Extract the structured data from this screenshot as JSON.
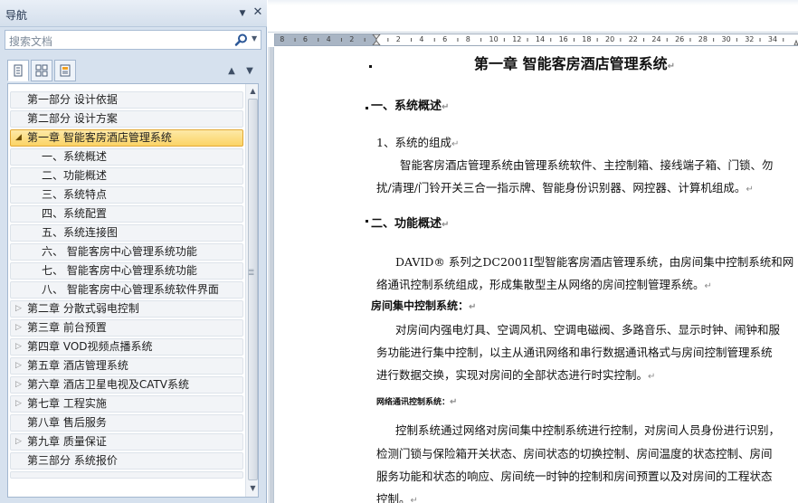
{
  "nav": {
    "title": "导航",
    "close_glyph": "✕",
    "menu_glyph": "▼",
    "search_placeholder": "搜索文档",
    "view_tabs": [
      "headings-view-icon",
      "pages-view-icon",
      "results-view-icon"
    ],
    "items": [
      {
        "label": "第一部分  设计依据",
        "level": 1,
        "expander": ""
      },
      {
        "label": "第二部分 设计方案",
        "level": 1,
        "expander": ""
      },
      {
        "label": "第一章  智能客房酒店管理系统",
        "level": 1,
        "expander": "◢",
        "selected": true
      },
      {
        "label": "一、系统概述",
        "level": 2,
        "expander": ""
      },
      {
        "label": "二、功能概述",
        "level": 2,
        "expander": ""
      },
      {
        "label": "三、系统特点",
        "level": 2,
        "expander": ""
      },
      {
        "label": "四、系统配置",
        "level": 2,
        "expander": ""
      },
      {
        "label": "五、系统连接图",
        "level": 2,
        "expander": ""
      },
      {
        "label": "六、  智能客房中心管理系统功能",
        "level": 2,
        "expander": ""
      },
      {
        "label": "七、   智能客房中心管理系统功能",
        "level": 2,
        "expander": ""
      },
      {
        "label": "八、   智能客房中心管理系统软件界面",
        "level": 2,
        "expander": ""
      },
      {
        "label": "第二章    分散式弱电控制",
        "level": 1,
        "expander": "▷"
      },
      {
        "label": "第三章  前台预置",
        "level": 1,
        "expander": "▷"
      },
      {
        "label": "第四章  VOD视频点播系统",
        "level": 1,
        "expander": "▷"
      },
      {
        "label": "第五章  酒店管理系统",
        "level": 1,
        "expander": "▷"
      },
      {
        "label": "第六章  酒店卫星电视及CATV系统",
        "level": 1,
        "expander": "▷"
      },
      {
        "label": "第七章  工程实施",
        "level": 1,
        "expander": "▷"
      },
      {
        "label": "第八章 售后服务",
        "level": 1,
        "expander": ""
      },
      {
        "label": "第九章 质量保证",
        "level": 1,
        "expander": "▷"
      },
      {
        "label": "第三部分  系统报价",
        "level": 1,
        "expander": ""
      }
    ]
  },
  "ruler": {
    "labels": [
      "8",
      "6",
      "4",
      "2",
      "2",
      "4",
      "6",
      "8",
      "10",
      "12",
      "14",
      "16",
      "18",
      "20",
      "22",
      "24",
      "26",
      "28",
      "30",
      "32",
      "34"
    ]
  },
  "document": {
    "chapter_title": "第一章   智能客房酒店管理系统",
    "s1_heading": "一、系统概述",
    "s1_sub": "1、系统的组成",
    "s1_body_1": "智能客房酒店管理系统由管理系统软件、主控制箱、接线端子箱、门锁、勿",
    "s1_body_2": "扰/清理/门铃开关三合一指示牌、智能身份识别器、网控器、计算机组成。",
    "s2_heading": "二、功能概述",
    "s2_body_1": "DAVID® 系列之DC2001Ⅰ型智能客房酒店管理系统，由房间集中控制系统和网",
    "s2_body_2": "络通讯控制系统组成，形成集散型主从网络的房间控制管理系统。",
    "s2_sub1": "房间集中控制系统：",
    "s2_sub1_body_1": "对房间内强电灯具、空调风机、空调电磁阀、多路音乐、显示时钟、闹钟和服",
    "s2_sub1_body_2": "务功能进行集中控制，以主从通讯网络和串行数据通讯格式与房间控制管理系统",
    "s2_sub1_body_3": "进行数据交换，实现对房间的全部状态进行时实控制。",
    "s2_sub2": "网络通讯控制系统：",
    "s2_sub2_body_1": "控制系统通过网络对房间集中控制系统进行控制，对房间人员身份进行识别，",
    "s2_sub2_body_2": "检测门锁与保险箱开关状态、房间状态的切换控制、房间温度的状态控制、房间",
    "s2_sub2_body_3": "服务功能和状态的响应、房间统一时钟的控制和房间预置以及对房间的工程状态",
    "s2_sub2_body_4": "控制。",
    "para_mark": "↵"
  }
}
